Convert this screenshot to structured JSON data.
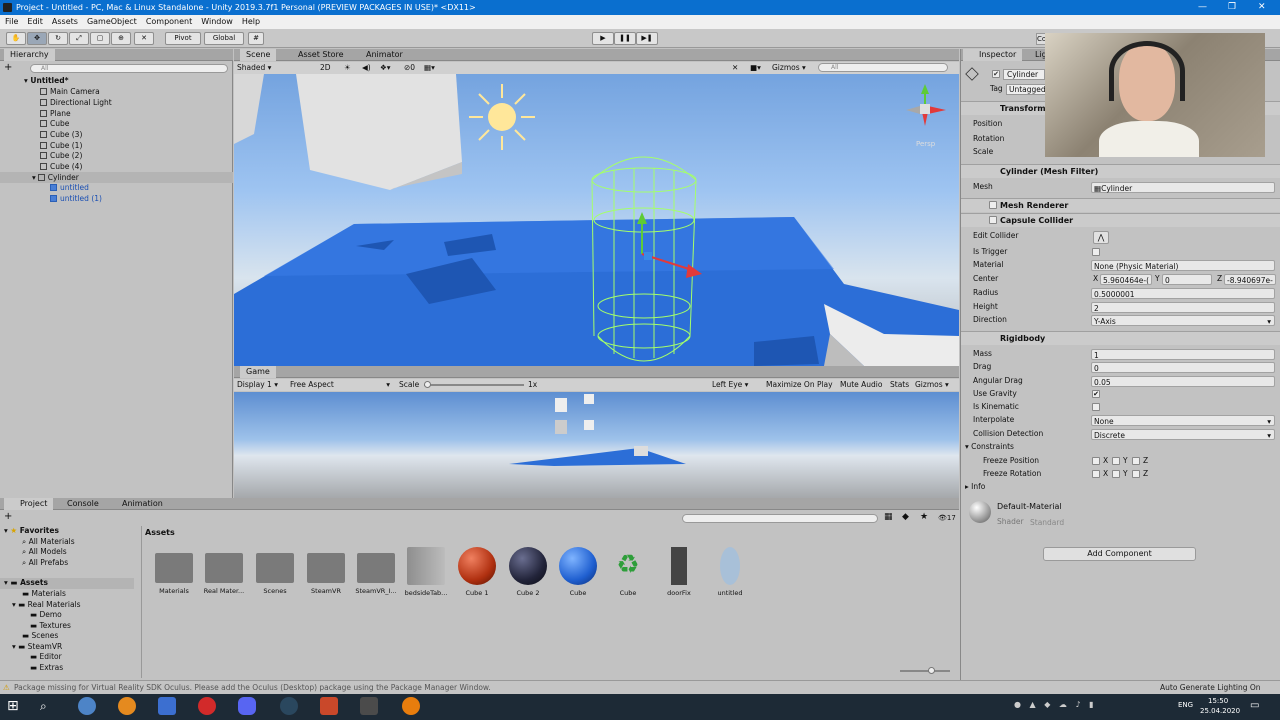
{
  "window": {
    "title": "Project - Untitled - PC, Mac & Linux Standalone - Unity 2019.3.7f1 Personal (PREVIEW PACKAGES IN USE)* <DX11>"
  },
  "menu": [
    "File",
    "Edit",
    "Assets",
    "GameObject",
    "Component",
    "Window",
    "Help"
  ],
  "toolbar": {
    "pivot": "Pivot",
    "global": "Global"
  },
  "hierarchy": {
    "tab": "Hierarchy",
    "add": "+",
    "search_placeholder": "All",
    "scene": "Untitled*",
    "items": [
      "Main Camera",
      "Directional Light",
      "Plane",
      "Cube",
      "Cube (3)",
      "Cube (1)",
      "Cube (2)",
      "Cube (4)",
      "Cylinder",
      "untitled",
      "untitled (1)"
    ]
  },
  "scene": {
    "tabs": [
      "Scene",
      "Asset Store",
      "Animator"
    ],
    "shading": "Shaded",
    "mode2d": "2D",
    "fx_count": "0",
    "gizmos": "Gizmos",
    "search_placeholder": "All",
    "persp": "Persp"
  },
  "game": {
    "tab": "Game",
    "display": "Display 1",
    "aspect": "Free Aspect",
    "scale_label": "Scale",
    "scale_value": "1x",
    "eye": "Left Eye",
    "maximize": "Maximize On Play",
    "mute": "Mute Audio",
    "stats": "Stats",
    "gizmos": "Gizmos"
  },
  "project": {
    "tabs": [
      "Project",
      "Console",
      "Animation"
    ],
    "favorites": "Favorites",
    "fav_items": [
      "All Materials",
      "All Models",
      "All Prefabs"
    ],
    "assets_root": "Assets",
    "tree": [
      "Materials",
      "Real Materials",
      "Demo",
      "Textures",
      "Scenes",
      "SteamVR",
      "Editor",
      "Extras"
    ],
    "breadcrumb": "Assets",
    "count": "17",
    "assets": [
      "Materials",
      "Real Mater...",
      "Scenes",
      "SteamVR",
      "SteamVR_I...",
      "bedsideTab...",
      "Cube 1",
      "Cube 2",
      "Cube",
      "Cube",
      "doorFix",
      "untitled"
    ]
  },
  "inspector": {
    "tab": "Inspector",
    "tab2": "Lig",
    "tab_mini": "Co",
    "object_name": "Cylinder",
    "tag_label": "Tag",
    "tag": "Untagged",
    "transform": {
      "title": "Transform",
      "position": "Position",
      "rotation": "Rotation",
      "scale": "Scale"
    },
    "mesh_filter": {
      "title": "Cylinder (Mesh Filter)",
      "mesh_label": "Mesh",
      "mesh_value": "Cylinder"
    },
    "mesh_renderer": "Mesh Renderer",
    "capsule": {
      "title": "Capsule Collider",
      "edit_collider": "Edit Collider",
      "is_trigger": "Is Trigger",
      "material_label": "Material",
      "material_value": "None (Physic Material)",
      "center_label": "Center",
      "center_x_label": "X",
      "center_x": "5.960464e-(",
      "center_y_label": "Y",
      "center_y": "0",
      "center_z_label": "Z",
      "center_z": "-8.940697e-",
      "radius_label": "Radius",
      "radius": "0.5000001",
      "height_label": "Height",
      "height": "2",
      "direction_label": "Direction",
      "direction": "Y-Axis"
    },
    "rigidbody": {
      "title": "Rigidbody",
      "mass_label": "Mass",
      "mass": "1",
      "drag_label": "Drag",
      "drag": "0",
      "angular_label": "Angular Drag",
      "angular": "0.05",
      "gravity_label": "Use Gravity",
      "kinematic_label": "Is Kinematic",
      "interpolate_label": "Interpolate",
      "interpolate": "None",
      "collision_label": "Collision Detection",
      "collision": "Discrete",
      "constraints": "Constraints",
      "freeze_pos": "Freeze Position",
      "freeze_rot": "Freeze Rotation",
      "axes": [
        "X",
        "Y",
        "Z"
      ],
      "info": "Info"
    },
    "material": {
      "name": "Default-Material",
      "shader_label": "Shader",
      "shader": "Standard"
    },
    "add_component": "Add Component"
  },
  "status": {
    "message": "Package missing for Virtual Reality SDK Oculus. Please add the Oculus (Desktop) package using the Package Manager Window.",
    "lighting": "Auto Generate Lighting On"
  },
  "taskbar": {
    "lang": "ENG",
    "time": "15:50",
    "date": "25.04.2020"
  },
  "colors": {
    "titlebar": "#0a6fcf",
    "selection": "#3a72c4",
    "panel": "#c2c2c2",
    "collider": "#a5ff6a"
  }
}
